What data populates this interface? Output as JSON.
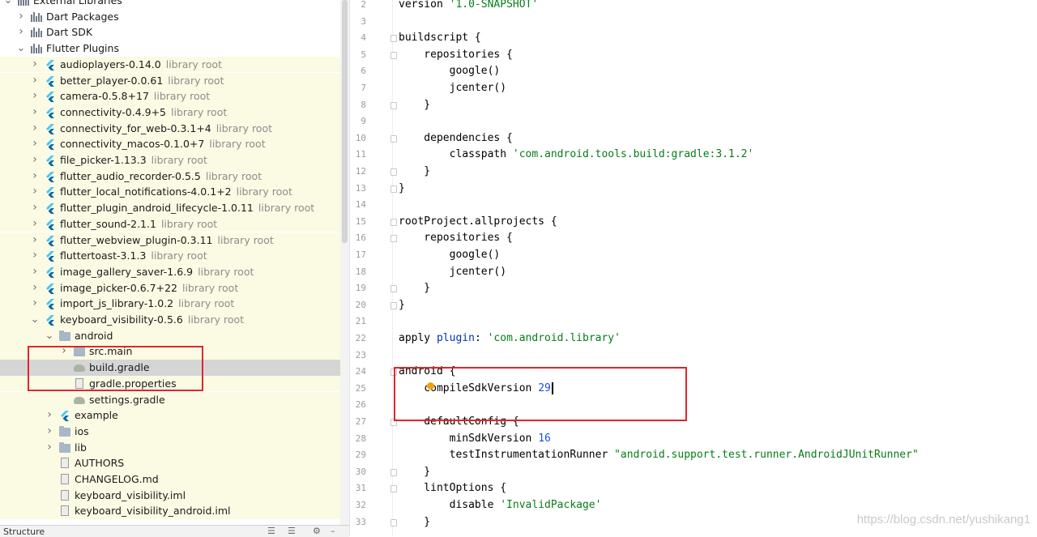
{
  "project_tree": {
    "top": [
      {
        "label": "External Libraries",
        "icon": "library-icon",
        "expanded": true
      },
      {
        "label": "Dart Packages",
        "icon": "library-icon",
        "expanded": false
      },
      {
        "label": "Dart SDK",
        "icon": "library-icon",
        "expanded": false
      },
      {
        "label": "Flutter Plugins",
        "icon": "library-icon",
        "expanded": true
      }
    ],
    "plugins": [
      {
        "name": "audioplayers-0.14.0",
        "suffix": "library root"
      },
      {
        "name": "better_player-0.0.61",
        "suffix": "library root"
      },
      {
        "name": "camera-0.5.8+17",
        "suffix": "library root"
      },
      {
        "name": "connectivity-0.4.9+5",
        "suffix": "library root"
      },
      {
        "name": "connectivity_for_web-0.3.1+4",
        "suffix": "library root"
      },
      {
        "name": "connectivity_macos-0.1.0+7",
        "suffix": "library root"
      },
      {
        "name": "file_picker-1.13.3",
        "suffix": "library root"
      },
      {
        "name": "flutter_audio_recorder-0.5.5",
        "suffix": "library root"
      },
      {
        "name": "flutter_local_notifications-4.0.1+2",
        "suffix": "library root"
      },
      {
        "name": "flutter_plugin_android_lifecycle-1.0.11",
        "suffix": "library root"
      },
      {
        "name": "flutter_sound-2.1.1",
        "suffix": "library root"
      },
      {
        "name": "flutter_webview_plugin-0.3.11",
        "suffix": "library root"
      },
      {
        "name": "fluttertoast-3.1.3",
        "suffix": "library root"
      },
      {
        "name": "image_gallery_saver-1.6.9",
        "suffix": "library root"
      },
      {
        "name": "image_picker-0.6.7+22",
        "suffix": "library root"
      },
      {
        "name": "import_js_library-1.0.2",
        "suffix": "library root"
      },
      {
        "name": "keyboard_visibility-0.5.6",
        "suffix": "library root"
      }
    ],
    "android_folder": "android",
    "android_children": [
      {
        "label": "src.main",
        "icon": "folder-icon",
        "chevron": true
      },
      {
        "label": "build.gradle",
        "icon": "gradle-icon",
        "selected": true
      },
      {
        "label": "gradle.properties",
        "icon": "properties-file-icon"
      },
      {
        "label": "settings.gradle",
        "icon": "gradle-icon"
      }
    ],
    "siblings": [
      {
        "label": "example",
        "icon": "flutter-icon",
        "chevron": true
      },
      {
        "label": "ios",
        "icon": "folder-icon",
        "chevron": true
      },
      {
        "label": "lib",
        "icon": "folder-icon",
        "chevron": true
      },
      {
        "label": "AUTHORS",
        "icon": "file-icon"
      },
      {
        "label": "CHANGELOG.md",
        "icon": "markdown-file-icon"
      },
      {
        "label": "keyboard_visibility.iml",
        "icon": "module-file-icon"
      },
      {
        "label": "keyboard_visibility_android.iml",
        "icon": "module-file-icon"
      }
    ]
  },
  "structure_panel": {
    "label": "Structure"
  },
  "editor": {
    "lines": [
      {
        "n": "2",
        "parts": [
          [
            "version ",
            "kw"
          ],
          [
            "'1.0-SNAPSHOT'",
            "str"
          ]
        ]
      },
      {
        "n": "3",
        "parts": []
      },
      {
        "n": "4",
        "parts": [
          [
            "buildscript {",
            "kw"
          ]
        ],
        "fold": true
      },
      {
        "n": "5",
        "parts": [
          [
            "    repositories {",
            "kw"
          ]
        ],
        "fold": true
      },
      {
        "n": "6",
        "parts": [
          [
            "        google()",
            "kw"
          ]
        ]
      },
      {
        "n": "7",
        "parts": [
          [
            "        jcenter()",
            "kw"
          ]
        ]
      },
      {
        "n": "8",
        "parts": [
          [
            "    }",
            "kw"
          ]
        ],
        "fold": true
      },
      {
        "n": "9",
        "parts": []
      },
      {
        "n": "10",
        "parts": [
          [
            "    dependencies {",
            "kw"
          ]
        ],
        "fold": true
      },
      {
        "n": "11",
        "parts": [
          [
            "        classpath ",
            "kw"
          ],
          [
            "'com.android.tools.build:gradle:3.1.2'",
            "str"
          ]
        ]
      },
      {
        "n": "12",
        "parts": [
          [
            "    }",
            "kw"
          ]
        ],
        "fold": true
      },
      {
        "n": "13",
        "parts": [
          [
            "}",
            "kw"
          ]
        ],
        "fold": true
      },
      {
        "n": "14",
        "parts": []
      },
      {
        "n": "15",
        "parts": [
          [
            "rootProject.allprojects {",
            "kw"
          ]
        ],
        "fold": true
      },
      {
        "n": "16",
        "parts": [
          [
            "    repositories {",
            "kw"
          ]
        ],
        "fold": true
      },
      {
        "n": "17",
        "parts": [
          [
            "        google()",
            "kw"
          ]
        ]
      },
      {
        "n": "18",
        "parts": [
          [
            "        jcenter()",
            "kw"
          ]
        ]
      },
      {
        "n": "19",
        "parts": [
          [
            "    }",
            "kw"
          ]
        ],
        "fold": true
      },
      {
        "n": "20",
        "parts": [
          [
            "}",
            "kw"
          ]
        ],
        "fold": true
      },
      {
        "n": "21",
        "parts": []
      },
      {
        "n": "22",
        "parts": [
          [
            "apply ",
            "kw"
          ],
          [
            "plugin",
            "gl"
          ],
          [
            ": ",
            "kw"
          ],
          [
            "'com.android.library'",
            "str"
          ]
        ]
      },
      {
        "n": "23",
        "parts": []
      },
      {
        "n": "24",
        "parts": [
          [
            "android {",
            "kw"
          ]
        ],
        "fold": true
      },
      {
        "n": "25",
        "parts": [
          [
            "    compileSdkVersion ",
            "kw"
          ],
          [
            "29",
            "num"
          ]
        ],
        "caret": true
      },
      {
        "n": "26",
        "parts": []
      },
      {
        "n": "27",
        "parts": [
          [
            "    defaultConfig {",
            "kw"
          ]
        ],
        "fold": true
      },
      {
        "n": "28",
        "parts": [
          [
            "        minSdkVersion ",
            "kw"
          ],
          [
            "16",
            "num"
          ]
        ]
      },
      {
        "n": "29",
        "parts": [
          [
            "        testInstrumentationRunner ",
            "kw"
          ],
          [
            "\"android.support.test.runner.AndroidJUnitRunner\"",
            "str"
          ]
        ]
      },
      {
        "n": "30",
        "parts": [
          [
            "    }",
            "kw"
          ]
        ],
        "fold": true
      },
      {
        "n": "31",
        "parts": [
          [
            "    lintOptions {",
            "kw"
          ]
        ],
        "fold": true
      },
      {
        "n": "32",
        "parts": [
          [
            "        disable ",
            "kw"
          ],
          [
            "'InvalidPackage'",
            "str"
          ]
        ]
      },
      {
        "n": "33",
        "parts": [
          [
            "    }",
            "kw"
          ]
        ],
        "fold": true
      }
    ]
  },
  "watermark": "https://blog.csdn.net/yushikang1",
  "colors": {
    "highlight": "#e0262b",
    "string": "#067d17",
    "number": "#1750eb",
    "plugin_row_bg": "#fbfbe4",
    "selection": "#d5d5d5"
  }
}
